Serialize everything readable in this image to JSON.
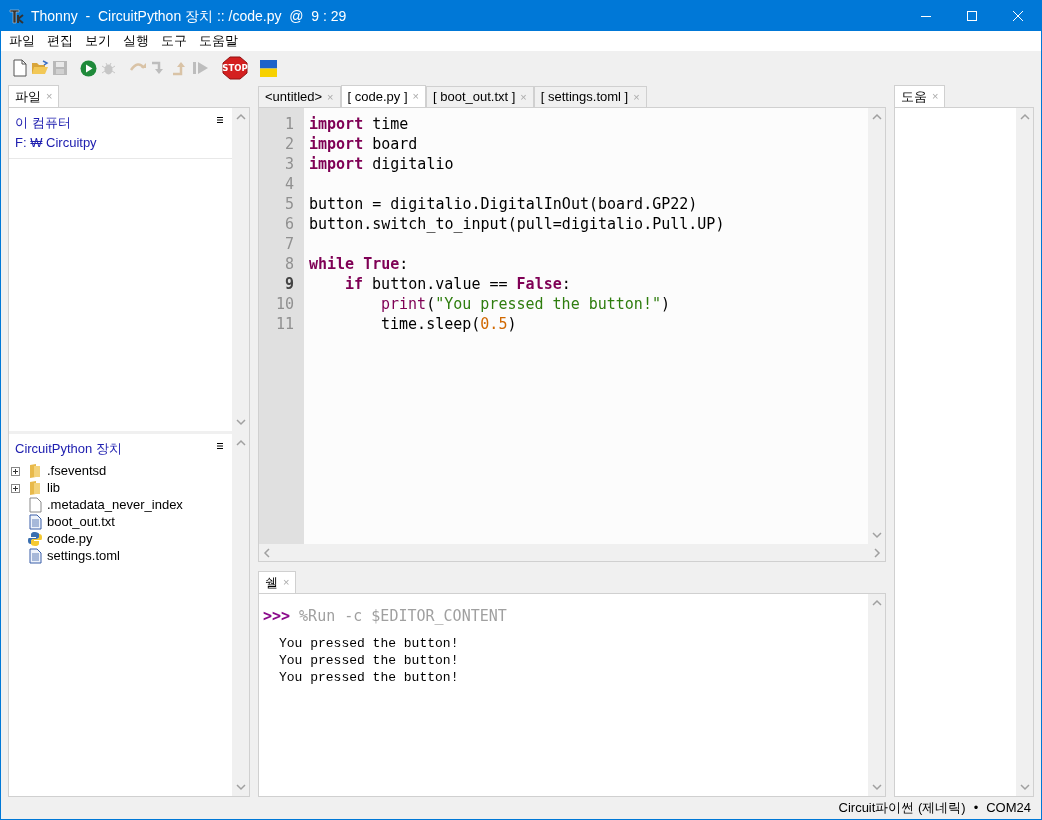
{
  "window": {
    "title": "Thonny  -  CircuitPython 장치 :: /code.py  @  9 : 29"
  },
  "menu": [
    "파일",
    "편집",
    "보기",
    "실행",
    "도구",
    "도움말"
  ],
  "toolbar": [
    {
      "kind": "new",
      "disabled": false
    },
    {
      "kind": "open",
      "disabled": false
    },
    {
      "kind": "save",
      "disabled": true
    },
    {
      "kind": "run",
      "disabled": false
    },
    {
      "kind": "debug",
      "disabled": true
    },
    {
      "kind": "step-over",
      "disabled": true
    },
    {
      "kind": "step-into",
      "disabled": true
    },
    {
      "kind": "step-out",
      "disabled": true
    },
    {
      "kind": "resume",
      "disabled": true
    },
    {
      "kind": "stop",
      "disabled": false,
      "label": "STOP"
    },
    {
      "kind": "flag",
      "disabled": false
    }
  ],
  "files_panel": {
    "tab": {
      "label": "파일",
      "close": "×"
    },
    "computer": {
      "title": "이 컴퓨터",
      "path": "F: ₩ Circuitpy"
    },
    "device": {
      "title": "CircuitPython 장치",
      "items": [
        {
          "name": ".fseventsd",
          "kind": "folder"
        },
        {
          "name": "lib",
          "kind": "folder"
        },
        {
          "name": ".metadata_never_index",
          "kind": "file"
        },
        {
          "name": "boot_out.txt",
          "kind": "text"
        },
        {
          "name": "code.py",
          "kind": "python"
        },
        {
          "name": "settings.toml",
          "kind": "text"
        }
      ]
    }
  },
  "editor": {
    "tabs": [
      {
        "label": "<untitled>",
        "close": "×",
        "selected": false
      },
      {
        "label": "[ code.py ]",
        "close": "×",
        "selected": true
      },
      {
        "label": "[ boot_out.txt ]",
        "close": "×",
        "selected": false
      },
      {
        "label": "[ settings.toml ]",
        "close": "×",
        "selected": false
      }
    ],
    "lines": [
      {
        "number": "1",
        "current": false,
        "kind": "top",
        "tokens": [
          {
            "kind": "kw",
            "text": "import"
          },
          {
            "kind": "plain",
            "text": " time"
          }
        ]
      },
      {
        "number": "2",
        "current": false,
        "kind": "top",
        "tokens": [
          {
            "kind": "kw",
            "text": "import"
          },
          {
            "kind": "plain",
            "text": " board"
          }
        ]
      },
      {
        "number": "3",
        "current": false,
        "kind": "top",
        "tokens": [
          {
            "kind": "kw",
            "text": "import"
          },
          {
            "kind": "plain",
            "text": " digitalio"
          }
        ]
      },
      {
        "number": "4",
        "current": false,
        "kind": "blank"
      },
      {
        "number": "5",
        "current": false,
        "kind": "top",
        "tokens": [
          {
            "kind": "plain",
            "text": "button = digitalio.DigitalInOut(board.GP22)"
          }
        ]
      },
      {
        "number": "6",
        "current": false,
        "kind": "top",
        "tokens": [
          {
            "kind": "plain",
            "text": "button.switch_to_input(pull=digitalio.Pull.UP)"
          }
        ]
      },
      {
        "number": "7",
        "current": false,
        "kind": "blank"
      },
      {
        "number": "8",
        "current": false,
        "kind": "top",
        "tokens": [
          {
            "kind": "kw",
            "text": "while True"
          },
          {
            "kind": "plain",
            "text": ":"
          }
        ]
      },
      {
        "number": "9",
        "current": true,
        "kind": "block",
        "tokens": [
          {
            "kind": "kw",
            "text": "if"
          },
          {
            "kind": "plain",
            "text": " button.value == "
          },
          {
            "kind": "kw",
            "text": "False"
          },
          {
            "kind": "plain",
            "text": ":"
          }
        ]
      },
      {
        "number": "10",
        "current": false,
        "kind": "nested",
        "tokens": [
          {
            "kind": "builtin",
            "text": "print"
          },
          {
            "kind": "plain",
            "text": "("
          },
          {
            "kind": "str",
            "text": "\"You pressed the button!\""
          },
          {
            "kind": "plain",
            "text": ")"
          }
        ]
      },
      {
        "number": "11",
        "current": false,
        "kind": "nested",
        "tokens": [
          {
            "kind": "plain",
            "text": "time.sleep("
          },
          {
            "kind": "num",
            "text": "0.5"
          },
          {
            "kind": "plain",
            "text": ")"
          }
        ]
      }
    ]
  },
  "shell": {
    "tab": {
      "label": "쉘",
      "close": "×"
    },
    "prompt": ">>>",
    "command": "%Run -c $EDITOR_CONTENT",
    "output": [
      "You pressed the button!",
      "You pressed the button!",
      "You pressed the button!"
    ]
  },
  "help_panel": {
    "tab": {
      "label": "도움",
      "close": "×"
    }
  },
  "status_bar": {
    "interpreter": "Circuit파이썬 (제네릭)",
    "separator": "•",
    "port": "COM24"
  }
}
